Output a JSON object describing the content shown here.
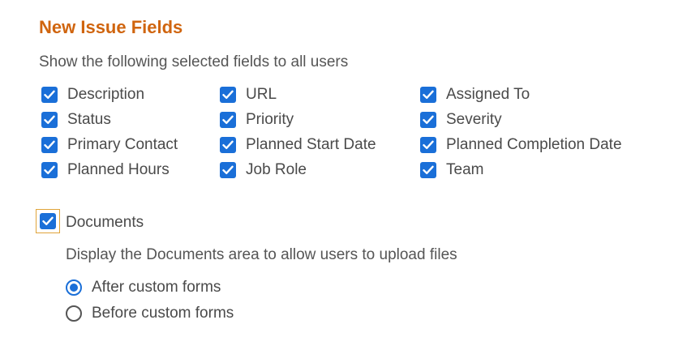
{
  "section": {
    "title": "New Issue Fields",
    "subtitle": "Show the following selected fields to all users"
  },
  "fields": [
    {
      "label": "Description",
      "checked": true
    },
    {
      "label": "URL",
      "checked": true
    },
    {
      "label": "Assigned To",
      "checked": true
    },
    {
      "label": "Status",
      "checked": true
    },
    {
      "label": "Priority",
      "checked": true
    },
    {
      "label": "Severity",
      "checked": true
    },
    {
      "label": "Primary Contact",
      "checked": true
    },
    {
      "label": "Planned Start Date",
      "checked": true
    },
    {
      "label": "Planned Completion Date",
      "checked": true
    },
    {
      "label": "Planned Hours",
      "checked": true
    },
    {
      "label": "Job Role",
      "checked": true
    },
    {
      "label": "Team",
      "checked": true
    }
  ],
  "documents": {
    "label": "Documents",
    "checked": true,
    "description": "Display the Documents area to allow users to upload files",
    "options": [
      {
        "label": "After custom forms",
        "selected": true
      },
      {
        "label": "Before custom forms",
        "selected": false
      }
    ]
  },
  "colors": {
    "title": "#d0650f",
    "checkbox": "#1a6fd8",
    "focus_outline": "#e0a43a"
  },
  "icons": {
    "checkbox": "checkmark-icon",
    "radio": "radio-icon"
  }
}
